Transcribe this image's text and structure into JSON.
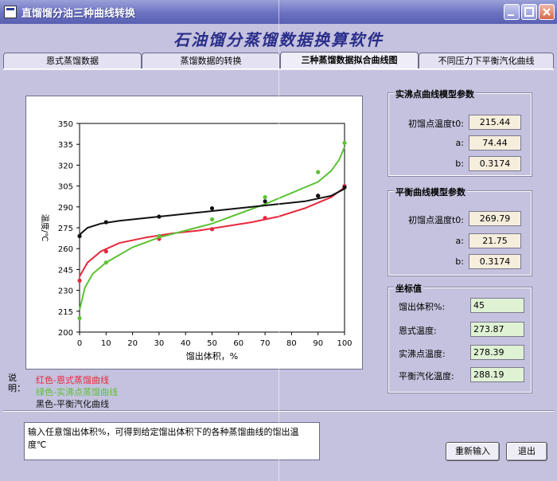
{
  "window": {
    "title": "直馏馏分油三种曲线转换"
  },
  "app_title": "石油馏分蒸馏数据换算软件",
  "tabs": [
    {
      "label": "恩式蒸馏数据"
    },
    {
      "label": "蒸馏数据的转换"
    },
    {
      "label": "三种蒸馏数据拟合曲线图"
    },
    {
      "label": "不同压力下平衡汽化曲线"
    }
  ],
  "chart_data": {
    "type": "line",
    "xlabel": "馏出体积，%",
    "ylabel": "温度/℃",
    "xlim": [
      0,
      100
    ],
    "ylim": [
      200,
      350
    ],
    "xticks": [
      0,
      10,
      20,
      30,
      40,
      50,
      60,
      70,
      80,
      90,
      100
    ],
    "yticks": [
      200,
      215,
      230,
      245,
      260,
      275,
      290,
      305,
      320,
      335,
      350
    ],
    "grid": false,
    "series": [
      {
        "name": "恩式蒸馏曲线",
        "color": "#e8283c",
        "curve": [
          [
            0,
            240
          ],
          [
            3,
            250
          ],
          [
            8,
            258
          ],
          [
            15,
            264
          ],
          [
            25,
            268
          ],
          [
            35,
            271
          ],
          [
            45,
            273
          ],
          [
            55,
            276
          ],
          [
            65,
            279
          ],
          [
            75,
            283
          ],
          [
            85,
            289
          ],
          [
            95,
            297
          ],
          [
            100,
            304
          ]
        ],
        "points": [
          [
            0,
            237
          ],
          [
            10,
            258
          ],
          [
            30,
            267
          ],
          [
            50,
            274
          ],
          [
            70,
            282
          ],
          [
            90,
            298
          ],
          [
            100,
            305
          ]
        ]
      },
      {
        "name": "实沸点蒸馏曲线",
        "color": "#5cc236",
        "curve": [
          [
            0,
            216
          ],
          [
            2,
            232
          ],
          [
            5,
            242
          ],
          [
            10,
            250
          ],
          [
            20,
            261
          ],
          [
            30,
            268
          ],
          [
            40,
            273
          ],
          [
            50,
            278
          ],
          [
            60,
            285
          ],
          [
            70,
            292
          ],
          [
            80,
            300
          ],
          [
            90,
            308
          ],
          [
            95,
            316
          ],
          [
            98,
            324
          ],
          [
            100,
            333
          ]
        ],
        "points": [
          [
            0,
            210
          ],
          [
            10,
            250
          ],
          [
            30,
            269
          ],
          [
            50,
            281
          ],
          [
            70,
            297
          ],
          [
            90,
            315
          ],
          [
            100,
            336
          ]
        ]
      },
      {
        "name": "平衡汽化曲线",
        "color": "#111111",
        "curve": [
          [
            0,
            270
          ],
          [
            3,
            275
          ],
          [
            8,
            278
          ],
          [
            15,
            280
          ],
          [
            25,
            282
          ],
          [
            35,
            284
          ],
          [
            45,
            286
          ],
          [
            55,
            288
          ],
          [
            65,
            290
          ],
          [
            75,
            292
          ],
          [
            85,
            294
          ],
          [
            95,
            298
          ],
          [
            100,
            303
          ]
        ],
        "points": [
          [
            0,
            269
          ],
          [
            10,
            279
          ],
          [
            30,
            283
          ],
          [
            50,
            289
          ],
          [
            70,
            294
          ],
          [
            90,
            298
          ],
          [
            100,
            304
          ]
        ]
      }
    ]
  },
  "legend": {
    "label": "说明：",
    "items": [
      {
        "text": "红色-恩式蒸馏曲线",
        "color": "#e8283c"
      },
      {
        "text": "绿色-实沸点蒸馏曲线",
        "color": "#5cc236"
      },
      {
        "text": "黑色-平衡汽化曲线",
        "color": "#111111"
      }
    ]
  },
  "tbp_params": {
    "title": "实沸点曲线模型参数",
    "rows": [
      {
        "label": "初馏点温度t0:",
        "value": "215.44"
      },
      {
        "label": "a:",
        "value": "74.44"
      },
      {
        "label": "b:",
        "value": "0.3174"
      }
    ]
  },
  "efv_params": {
    "title": "平衡曲线模型参数",
    "rows": [
      {
        "label": "初馏点温度t0:",
        "value": "269.79"
      },
      {
        "label": "a:",
        "value": "21.75"
      },
      {
        "label": "b:",
        "value": "0.3174"
      }
    ]
  },
  "coords": {
    "title": "坐标值",
    "rows": [
      {
        "label": "馏出体积%:",
        "value": "45"
      },
      {
        "label": "恩式温度:",
        "value": "273.87"
      },
      {
        "label": "实沸点温度:",
        "value": "278.39"
      },
      {
        "label": "平衡汽化温度:",
        "value": "288.19"
      }
    ]
  },
  "instruction": "输入任意馏出体积%，可得到给定馏出体积下的各种蒸馏曲线的馏出温度℃",
  "buttons": {
    "reenter": "重新输入",
    "exit": "退出"
  }
}
